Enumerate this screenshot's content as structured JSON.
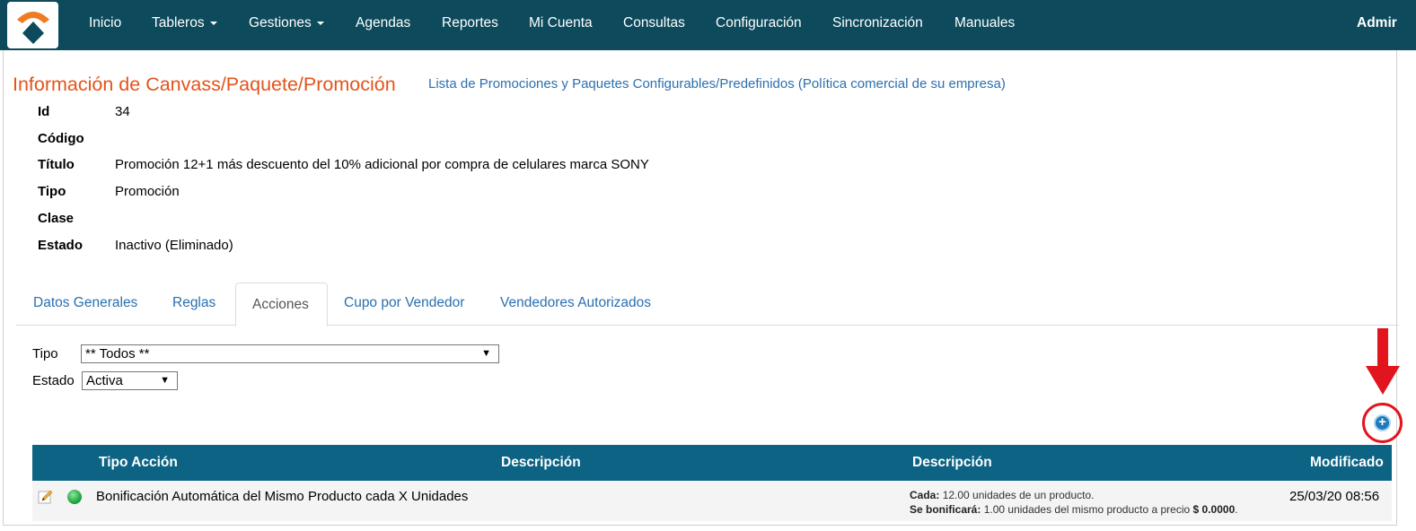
{
  "navbar": {
    "items": [
      {
        "label": "Inicio",
        "dropdown": false
      },
      {
        "label": "Tableros",
        "dropdown": true
      },
      {
        "label": "Gestiones",
        "dropdown": true
      },
      {
        "label": "Agendas",
        "dropdown": false
      },
      {
        "label": "Reportes",
        "dropdown": false
      },
      {
        "label": "Mi Cuenta",
        "dropdown": false
      },
      {
        "label": "Consultas",
        "dropdown": false
      },
      {
        "label": "Configuración",
        "dropdown": false
      },
      {
        "label": "Sincronización",
        "dropdown": false
      },
      {
        "label": "Manuales",
        "dropdown": false
      }
    ],
    "user": "Admir"
  },
  "header": {
    "title": "Información de Canvass/Paquete/Promoción",
    "link": "Lista de Promociones y Paquetes Configurables/Predefinidos (Política comercial de su empresa)"
  },
  "info": [
    {
      "label": "Id",
      "value": "34"
    },
    {
      "label": "Código",
      "value": ""
    },
    {
      "label": "Título",
      "value": "Promoción 12+1 más descuento del 10% adicional por compra de celulares marca SONY"
    },
    {
      "label": "Tipo",
      "value": "Promoción"
    },
    {
      "label": "Clase",
      "value": ""
    },
    {
      "label": "Estado",
      "value": "Inactivo (Eliminado)"
    }
  ],
  "tabs": [
    {
      "label": "Datos Generales"
    },
    {
      "label": "Reglas"
    },
    {
      "label": "Acciones",
      "active": true
    },
    {
      "label": "Cupo por Vendedor"
    },
    {
      "label": "Vendedores Autorizados"
    }
  ],
  "filters": {
    "tipo_label": "Tipo",
    "tipo_value": "** Todos **",
    "estado_label": "Estado",
    "estado_value": "Activa"
  },
  "table": {
    "headers": [
      "Tipo Acción",
      "Descripción",
      "Descripción",
      "Modificado"
    ],
    "rows": [
      {
        "tipo": "Bonificación Automática del Mismo Producto cada X Unidades",
        "desc_line1_label": "Cada:",
        "desc_line1_text": "12.00 unidades de un producto.",
        "desc_line2_label": "Se bonificará:",
        "desc_line2_text": "1.00 unidades del mismo producto a precio",
        "desc_line2_price": "$ 0.0000",
        "desc_line2_end": ".",
        "modificado": "25/03/20 08:56",
        "status_color": "#19a33a"
      }
    ]
  },
  "colors": {
    "navbar": "#0d4a5c",
    "table_header": "#0d6383",
    "title": "#e2541b",
    "link": "#2a6fb0",
    "highlight": "#e2141d"
  }
}
